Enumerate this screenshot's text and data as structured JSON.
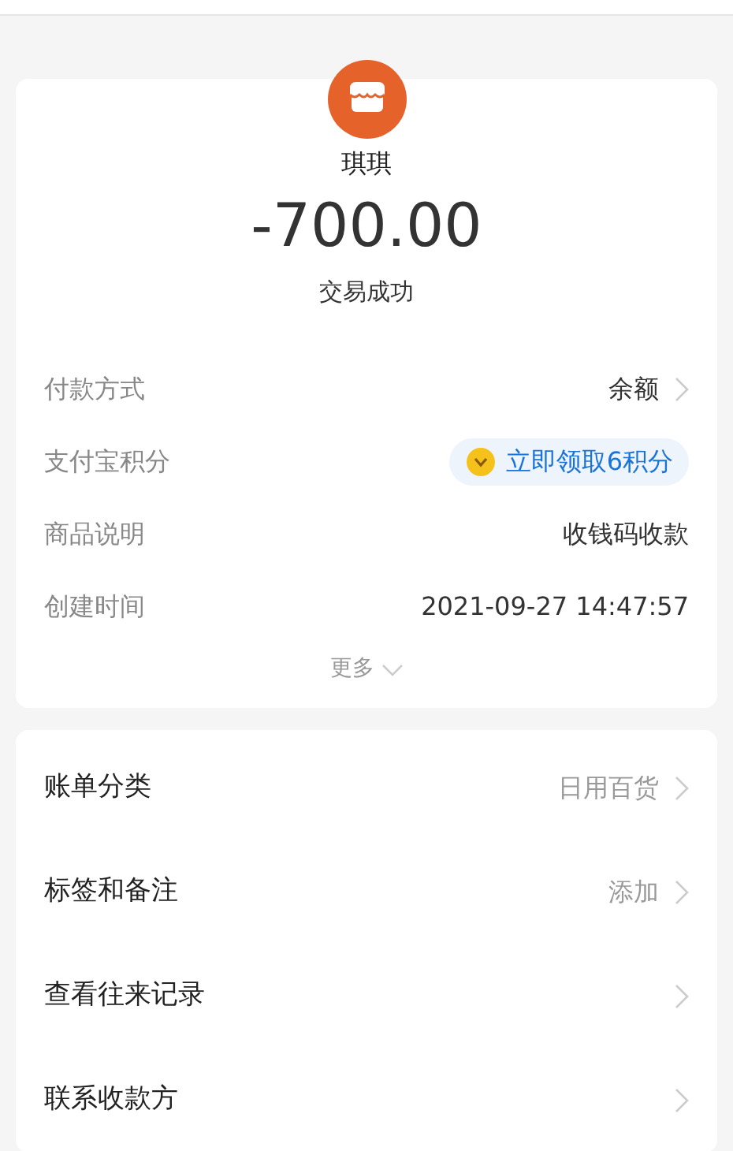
{
  "merchant": {
    "name": "琪琪",
    "amount": "-700.00",
    "status": "交易成功"
  },
  "details": [
    {
      "kind": "value",
      "label": "付款方式",
      "value": "余额",
      "chevron": true
    },
    {
      "kind": "badge",
      "label": "支付宝积分",
      "value": "立即领取6积分",
      "chevron": false
    },
    {
      "kind": "value",
      "label": "商品说明",
      "value": "收钱码收款",
      "chevron": false
    },
    {
      "kind": "value",
      "label": "创建时间",
      "value": "2021-09-27 14:47:57",
      "chevron": false
    }
  ],
  "more": "更多",
  "actions": [
    {
      "label": "账单分类",
      "value": "日用百货"
    },
    {
      "label": "标签和备注",
      "value": "添加"
    },
    {
      "label": "查看往来记录"
    },
    {
      "label": "联系收款方"
    }
  ]
}
